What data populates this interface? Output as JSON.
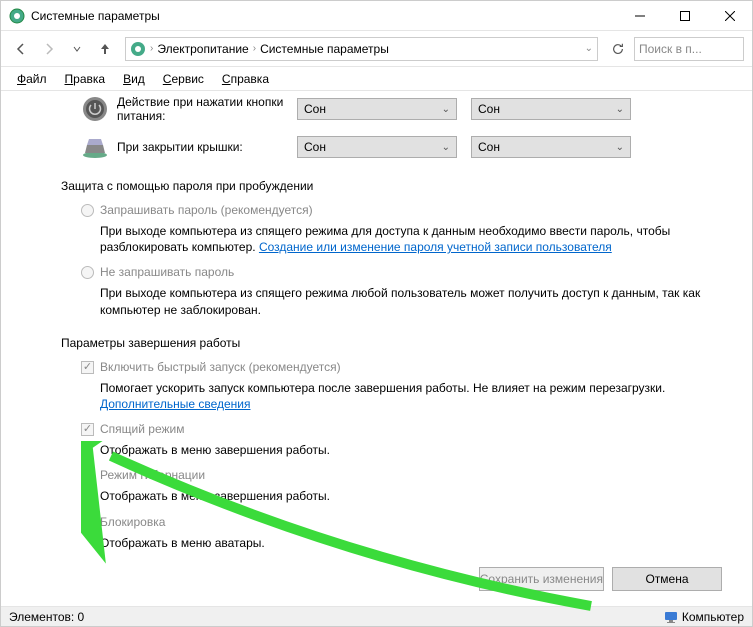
{
  "window": {
    "title": "Системные параметры"
  },
  "breadcrumb": {
    "item1": "Электропитание",
    "item2": "Системные параметры"
  },
  "search": {
    "placeholder": "Поиск в п..."
  },
  "menu": {
    "file": "айл",
    "file_u": "Ф",
    "edit": "равка",
    "edit_u": "П",
    "view": "ид",
    "view_u": "В",
    "service": "ервис",
    "service_u": "С",
    "help": "правка",
    "help_u": "С"
  },
  "settings": {
    "power_button": "Действие при нажатии кнопки питания:",
    "lid_close": "При закрытии крышки:",
    "opt_sleep": "Сон"
  },
  "sec_password": "Защита с помощью пароля при пробуждении",
  "radio1": {
    "label": "Запрашивать пароль (рекомендуется)",
    "desc_a": "При выходе компьютера из спящего режима для доступа к данным необходимо ввести пароль, чтобы разблокировать компьютер. ",
    "link": "Создание или изменение пароля учетной записи пользователя"
  },
  "radio2": {
    "label": "Не запрашивать пароль",
    "desc": "При выходе компьютера из спящего режима любой пользователь может получить доступ к данным, так как компьютер не заблокирован."
  },
  "sec_shutdown": "Параметры завершения работы",
  "chk1": {
    "label": "Включить быстрый запуск (рекомендуется)",
    "desc_a": "Помогает ускорить запуск компьютера после завершения работы. Не влияет на режим перезагрузки. ",
    "link": "Дополнительные сведения"
  },
  "chk2": {
    "label": "Спящий режим",
    "desc": "Отображать в меню завершения работы."
  },
  "chk3": {
    "label": "Режим гибернации",
    "desc": "Отображать в меню завершения работы."
  },
  "chk4": {
    "label": "Блокировка",
    "desc": "Отображать в меню аватары."
  },
  "buttons": {
    "save": "Сохранить изменения",
    "cancel": "Отмена"
  },
  "status": {
    "left": "Элементов: 0",
    "right": "Компьютер"
  }
}
